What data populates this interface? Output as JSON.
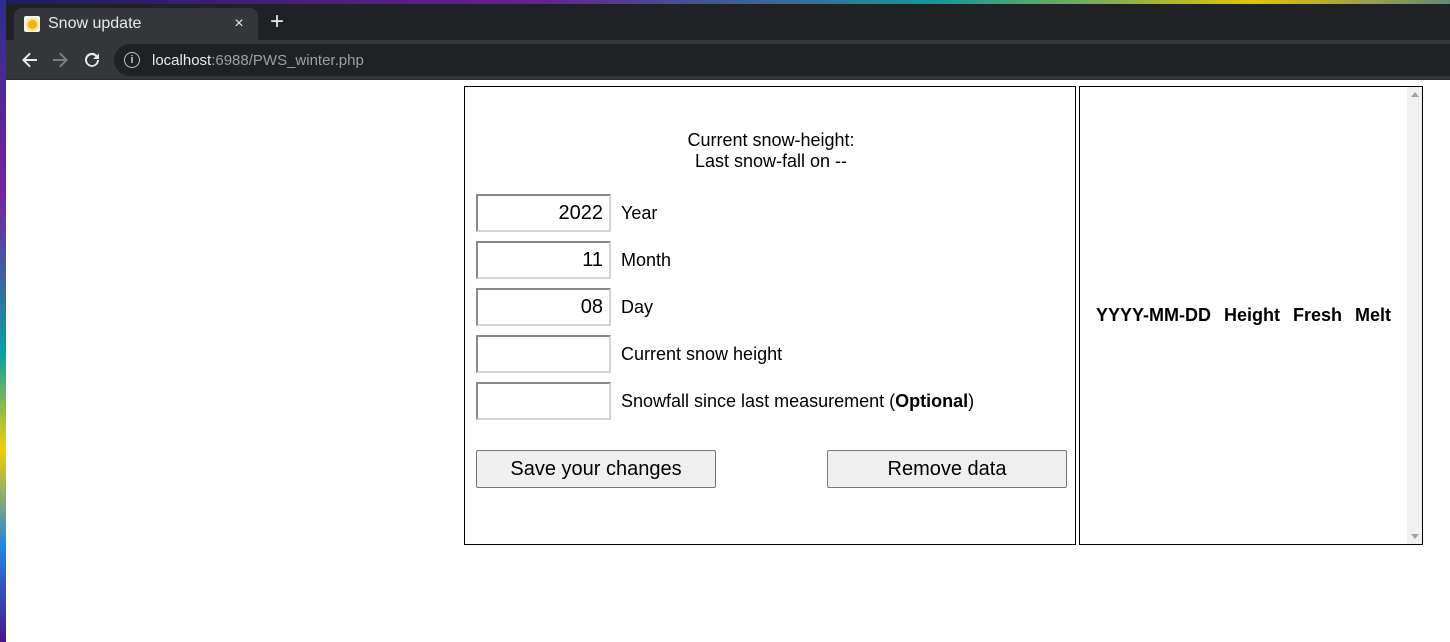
{
  "browser": {
    "tab_title": "Snow update",
    "close_glyph": "×",
    "newtab_glyph": "+",
    "url_host": "localhost",
    "url_rest": ":6988/PWS_winter.php"
  },
  "form": {
    "heading_line1": "Current snow-height:",
    "heading_line2": "Last snow-fall on --",
    "rows": [
      {
        "label": "Year",
        "value": "2022"
      },
      {
        "label": "Month",
        "value": "11"
      },
      {
        "label": "Day",
        "value": "08"
      },
      {
        "label": "Current snow height",
        "value": ""
      },
      {
        "label_prefix": "Snowfall since last measurement (",
        "label_bold": "Optional",
        "label_suffix": ")",
        "value": ""
      }
    ],
    "save_button": "Save your changes",
    "remove_button": "Remove data"
  },
  "history_table": {
    "headers": [
      "YYYY-MM-DD",
      "Height",
      "Fresh",
      "Melt"
    ]
  },
  "colors": {
    "tab_bg": "#35363a",
    "tabstrip_bg": "#202124",
    "button_bg": "#efefef"
  }
}
